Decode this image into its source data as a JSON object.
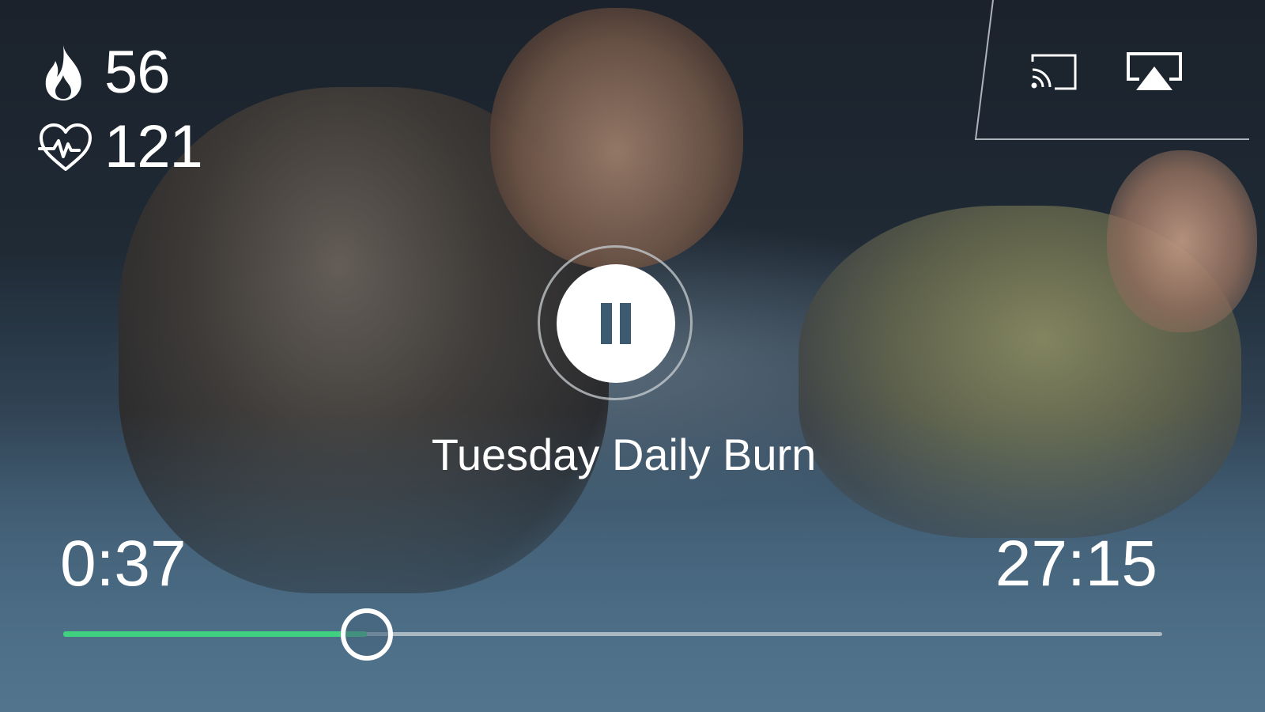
{
  "stats": {
    "calories": {
      "icon": "flame-icon",
      "value": "56"
    },
    "heart_rate": {
      "icon": "heart-rate-icon",
      "value": "121"
    }
  },
  "cast": {
    "chromecast_icon": "chromecast-icon",
    "airplay_icon": "airplay-icon"
  },
  "player": {
    "state_icon": "pause-icon",
    "title": "Tuesday Daily Burn",
    "elapsed": "0:37",
    "total": "27:15",
    "progress_fraction": 0.276
  },
  "colors": {
    "progress": "#3fd17f",
    "pause_icon": "#3c5a70",
    "text": "#ffffff"
  }
}
